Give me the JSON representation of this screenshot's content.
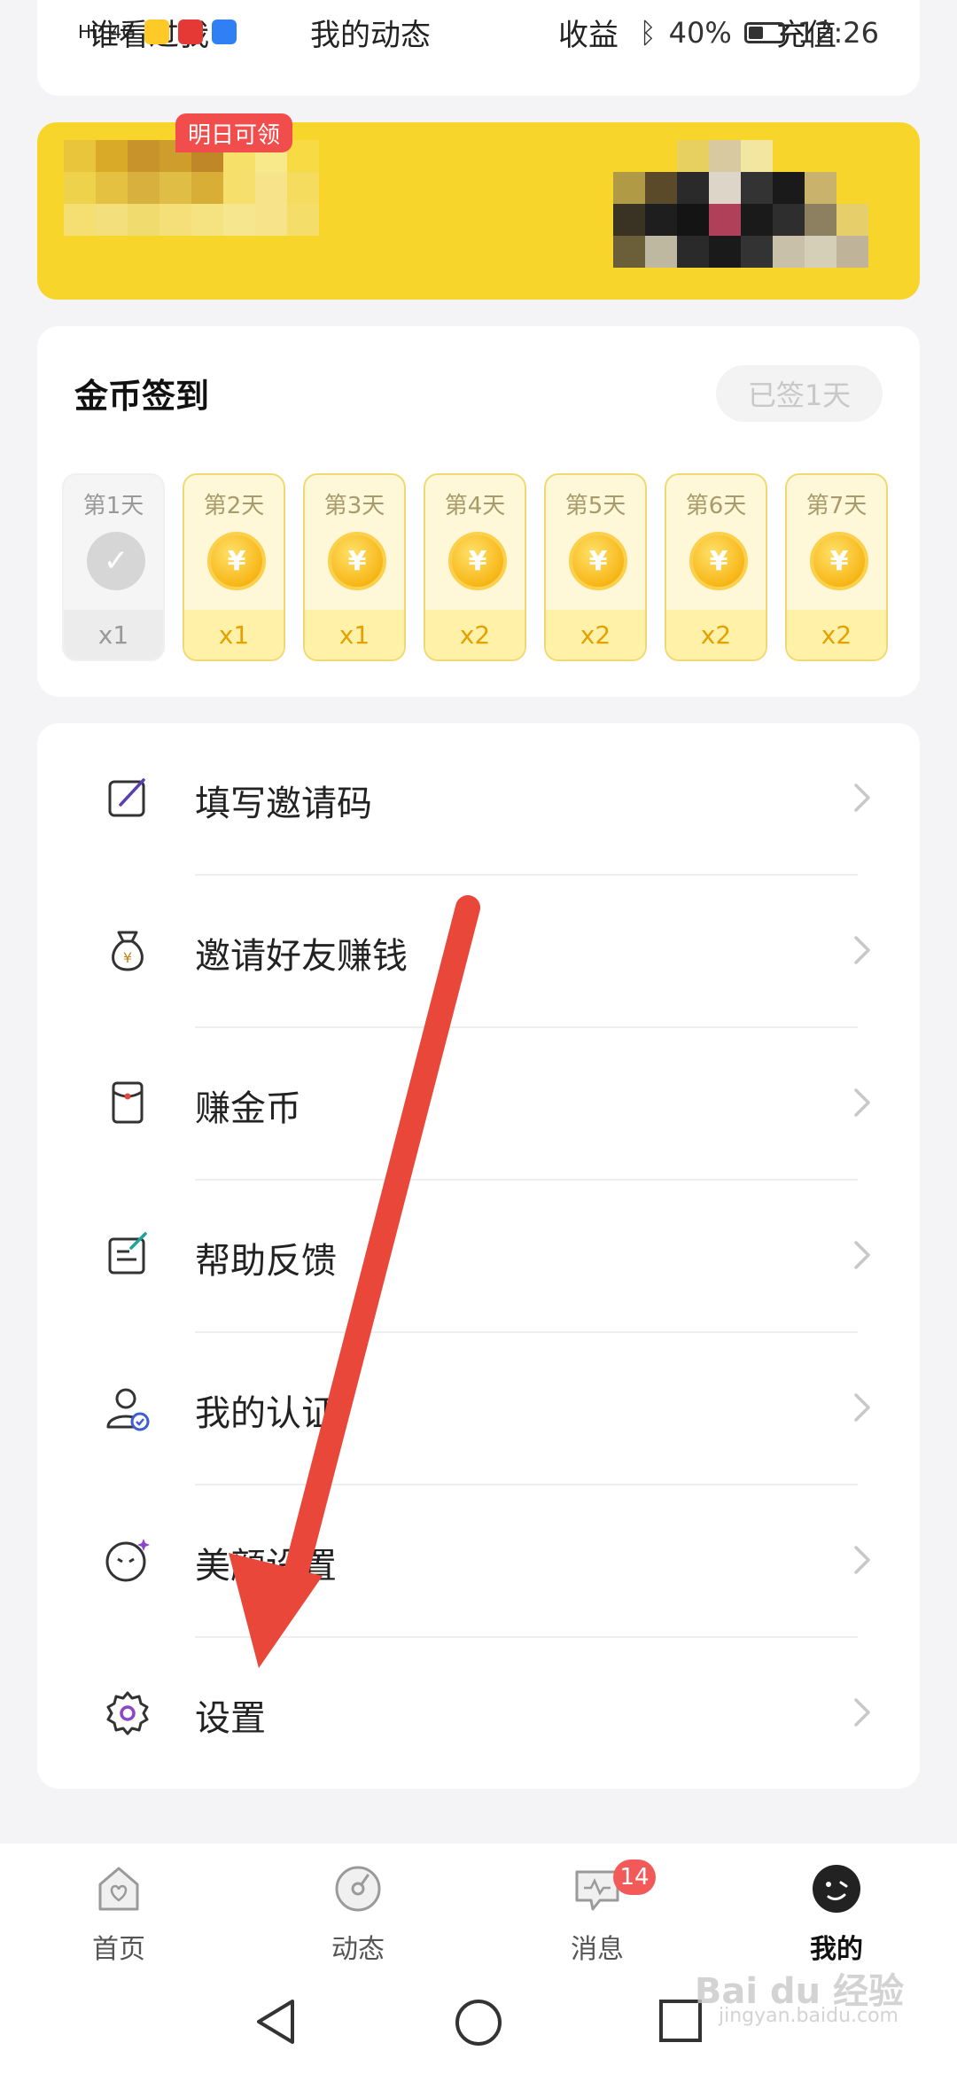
{
  "status_bar": {
    "left_text": "HD 4G",
    "battery": "40%",
    "time": "12:26"
  },
  "quick_actions": [
    {
      "label": "谁看过我"
    },
    {
      "label": "我的动态"
    },
    {
      "label": "收益"
    },
    {
      "label": "充值"
    }
  ],
  "sign_in": {
    "title": "金币签到",
    "status": "已签1天",
    "tomorrow_badge": "明日可领",
    "days": [
      {
        "label": "第1天",
        "reward": "x1",
        "state": "done"
      },
      {
        "label": "第2天",
        "reward": "x1",
        "state": "pending"
      },
      {
        "label": "第3天",
        "reward": "x1",
        "state": "pending"
      },
      {
        "label": "第4天",
        "reward": "x2",
        "state": "pending"
      },
      {
        "label": "第5天",
        "reward": "x2",
        "state": "pending"
      },
      {
        "label": "第6天",
        "reward": "x2",
        "state": "pending"
      },
      {
        "label": "第7天",
        "reward": "x2",
        "state": "pending"
      }
    ],
    "coin_symbol": "¥"
  },
  "menu": [
    {
      "label": "填写邀请码",
      "icon": "edit-icon"
    },
    {
      "label": "邀请好友赚钱",
      "icon": "money-bag-icon"
    },
    {
      "label": "赚金币",
      "icon": "red-envelope-icon"
    },
    {
      "label": "帮助反馈",
      "icon": "feedback-icon"
    },
    {
      "label": "我的认证",
      "icon": "verified-user-icon"
    },
    {
      "label": "美颜设置",
      "icon": "beauty-face-icon"
    },
    {
      "label": "设置",
      "icon": "gear-icon"
    }
  ],
  "bottom_nav": [
    {
      "label": "首页",
      "icon": "home-heart-icon"
    },
    {
      "label": "动态",
      "icon": "feed-disc-icon"
    },
    {
      "label": "消息",
      "icon": "message-icon",
      "badge": "14"
    },
    {
      "label": "我的",
      "icon": "profile-face-icon",
      "active": true
    }
  ],
  "watermark": {
    "brand": "Bai du 经验",
    "domain": "jingyan.baidu.com"
  },
  "colors": {
    "accent_yellow": "#f7d52a",
    "badge_red": "#f24d4d",
    "annotation_arrow": "#e8473a"
  }
}
